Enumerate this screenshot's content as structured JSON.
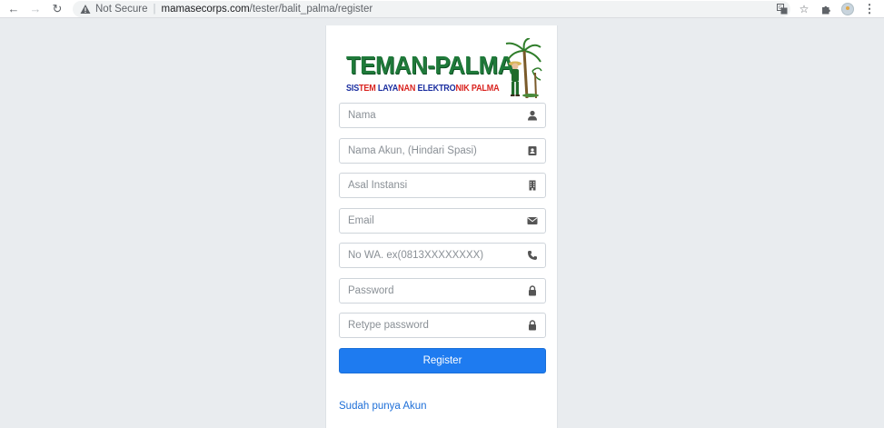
{
  "browser": {
    "security_label": "Not Secure",
    "url_host": "mamasecorps.com",
    "url_path": "/tester/balit_palma/register",
    "icons": [
      "back-icon",
      "forward-icon",
      "reload-icon",
      "warning-icon",
      "translate-icon",
      "star-icon",
      "extensions-icon",
      "profile-avatar",
      "kebab-menu-icon"
    ]
  },
  "logo": {
    "title": "TEMAN-PALMA",
    "subtitle_parts": [
      {
        "text": "SIS",
        "color": "#1c2fa0"
      },
      {
        "text": "TEM ",
        "color": "#d9231f"
      },
      {
        "text": "LAYA",
        "color": "#1c2fa0"
      },
      {
        "text": "NAN ",
        "color": "#d9231f"
      },
      {
        "text": "ELEKTRO",
        "color": "#1c2fa0"
      },
      {
        "text": "NIK ",
        "color": "#d9231f"
      },
      {
        "text": "PALMA",
        "color": "#d9231f"
      }
    ]
  },
  "form": {
    "fields": [
      {
        "placeholder": "Nama",
        "icon": "user-icon"
      },
      {
        "placeholder": "Nama Akun, (Hindari Spasi)",
        "icon": "id-card-icon"
      },
      {
        "placeholder": "Asal Instansi",
        "icon": "building-icon"
      },
      {
        "placeholder": "Email",
        "icon": "envelope-icon"
      },
      {
        "placeholder": "No WA. ex(0813XXXXXXXX)",
        "icon": "phone-icon"
      },
      {
        "placeholder": "Password",
        "icon": "lock-icon"
      },
      {
        "placeholder": "Retype password",
        "icon": "lock-icon"
      }
    ],
    "submit_label": "Register",
    "login_link": "Sudah punya Akun"
  },
  "colors": {
    "page_bg": "#e9ecef",
    "primary": "#1e7bf0",
    "logo_green": "#1f7a3a",
    "logo_blue": "#1c2fa0",
    "logo_red": "#d9231f"
  }
}
